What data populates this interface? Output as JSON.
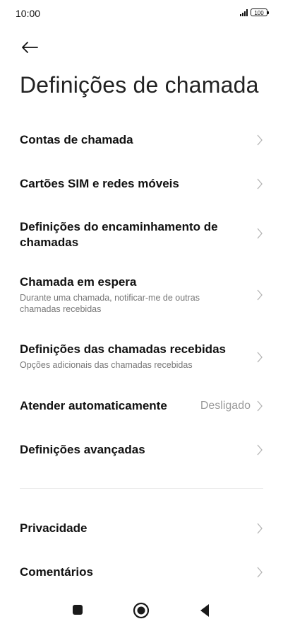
{
  "status": {
    "time": "10:00",
    "battery": "100"
  },
  "header": {
    "back_icon": "arrow-left-icon",
    "title": "Definições de chamada"
  },
  "items": [
    {
      "title": "Contas de chamada"
    },
    {
      "title": "Cartões SIM e redes móveis"
    },
    {
      "title": "Definições do encaminhamento de chamadas"
    },
    {
      "title": "Chamada em espera",
      "subtitle": "Durante uma chamada, notificar-me de outras chamadas recebidas"
    },
    {
      "title": "Definições das chamadas recebidas",
      "subtitle": "Opções adicionais das chamadas recebidas"
    },
    {
      "title": "Atender automaticamente",
      "value": "Desligado"
    },
    {
      "title": "Definições avançadas"
    },
    {
      "title": "Privacidade"
    },
    {
      "title": "Comentários"
    }
  ],
  "nav": {
    "recents_icon": "square-icon",
    "home_icon": "circle-icon",
    "back_icon": "triangle-back-icon"
  },
  "colors": {
    "background": "#ffffff",
    "text": "#111111",
    "secondary_text": "#777777",
    "chevron": "#b5b5b5"
  }
}
